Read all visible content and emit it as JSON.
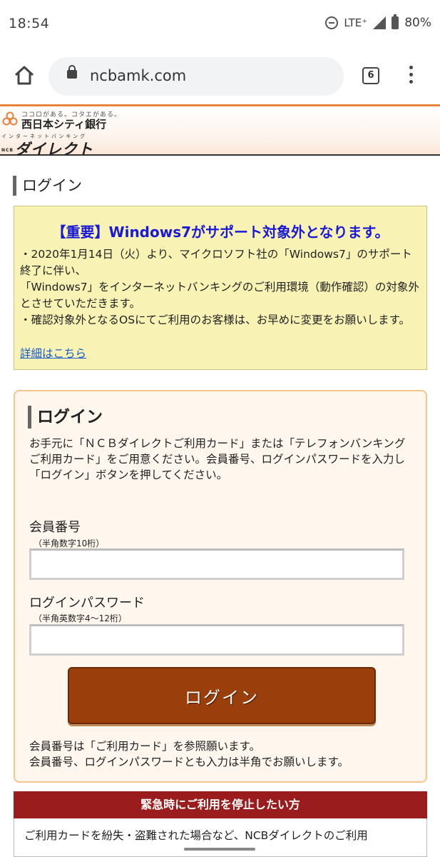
{
  "status_bar": {
    "time": "18:54",
    "network": "LTE⁺",
    "battery": "80%"
  },
  "browser": {
    "url": "ncbamk.com",
    "tab_count": "6"
  },
  "site_header": {
    "tagline": "ココロがある。コタエがある。",
    "bank_name": "西日本シティ銀行",
    "service_label": "インターネットバンキング",
    "ncb_mark": "NCB",
    "service_name": "ダイレクト"
  },
  "page": {
    "title": "ログイン"
  },
  "notice": {
    "title": "【重要】Windows7がサポート対象外となります。",
    "lines": [
      "・2020年1月14日（火）より、マイクロソフト社の「Windows7」のサポート終了に伴い、",
      "「Windows7」をインターネットバンキングのご利用環境（動作確認）の対象外とさせていただきます。",
      "・確認対象外となるOSにてご利用のお客様は、お早めに変更をお願いします。"
    ],
    "link_label": "詳細はこちら"
  },
  "login": {
    "title": "ログイン",
    "description": "お手元に「ＮＣＢダイレクトご利用カード」または「テレフォンバンキングご利用カード」をご用意ください。会員番号、ログインパスワードを入力し「ログイン」ボタンを押してください。",
    "member_label": "会員番号",
    "member_hint": "（半角数字10桁）",
    "member_value": "",
    "password_label": "ログインパスワード",
    "password_hint": "（半角英数字4～12桁）",
    "password_value": "",
    "button_label": "ログイン",
    "note_lines": [
      "会員番号は「ご利用カード」を参照願います。",
      "会員番号、ログインパスワードとも入力は半角でお願いします。"
    ]
  },
  "emergency": {
    "title": "緊急時にご利用を停止したい方",
    "body": "ご利用カードを紛失・盗難された場合など、NCBダイレクトのご利用"
  },
  "colors": {
    "accent_orange": "#e9823a",
    "notice_bg": "#f8f2b4",
    "notice_title": "#1a1ad6",
    "login_button": "#9a3f0c",
    "emergency_header": "#9b1c1c"
  }
}
